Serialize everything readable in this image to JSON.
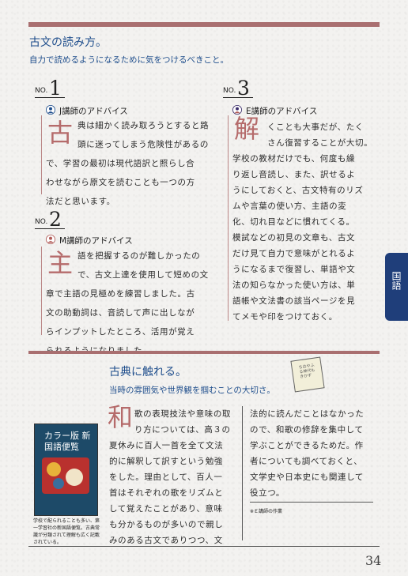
{
  "heading": {
    "title": "古文の読み方。",
    "subtitle": "自力で読めるようになるために気をつけるべきこと。"
  },
  "no_prefix": "NO.",
  "advice": [
    {
      "num": "1",
      "label": "J講師のアドバイス",
      "drop": "古",
      "lines": [
        "典は細かく読み取ろうとすると路",
        "頭に迷ってしまう危険性があるの",
        "で、学習の最初は現代語訳と照らし合",
        "わせながら原文を読むことも一つの方",
        "法だと思います。"
      ]
    },
    {
      "num": "2",
      "label": "M講師のアドバイス",
      "drop": "主",
      "lines": [
        "語を把握するのが難しかったの",
        "で、古文上達を使用して短めの文",
        "章で主語の見極めを練習しました。古",
        "文の助動詞は、音読して声に出しなが",
        "らインプットしたところ、活用が覚え",
        "られるようになりました。"
      ]
    },
    {
      "num": "3",
      "label": "E講師のアドバイス",
      "drop": "解",
      "lines": [
        "くことも大事だが、たく",
        "さん復習することが大切。",
        "学校の教材だけでも、何度も繰",
        "り返し音読し、また、訳せるよ",
        "うにしておくと、古文特有のリズ",
        "ムや言葉の使い方、主語の変",
        "化、切れ目などに慣れてくる。",
        "模試などの初見の文章も、古文",
        "だけ見て自力で意味がとれるよ",
        "うになるまで復習し、単語や文",
        "法の知らなかった使い方は、単",
        "語帳や文法書の該当ページを見",
        "てメモや印をつけておく。"
      ]
    }
  ],
  "tab": {
    "label": "国語"
  },
  "classics": {
    "title": "古典に触れる。",
    "subtitle": "当時の雰囲気や世界観を掴むことの大切さ。",
    "drop": "和",
    "col1": [
      "歌の表現技法や意味の取",
      "り方については、高３の",
      "夏休みに百人一首を全て文法",
      "的に解釈して訳すという勉強",
      "をした。理由として、百人一",
      "首はそれぞれの歌をリズムと",
      "して覚えたことがあり、意味",
      "も分かるものが多いので親し",
      "みのある古文でありつつ、文"
    ],
    "col2": [
      "法的に読んだことはなかった",
      "ので、和歌の修辞を集中して",
      "学ぶことができるためだ。作",
      "者についても調べておくと、",
      "文学史や日本史にも関連して",
      "役立つ。"
    ],
    "note": "※Ｅ講師の作業",
    "book": {
      "title": "カラー版 新国語便覧",
      "caption": "学校で配られることも多い、第一学習社の新国語便覧。古典常識が分類されて理解も広く記載されている。"
    },
    "card_text": "ちはやふる神代もきかず"
  },
  "page_number": "34",
  "colors": {
    "accent": "#a96f70",
    "blue": "#1f4e8c",
    "tab": "#1f3e7a"
  }
}
